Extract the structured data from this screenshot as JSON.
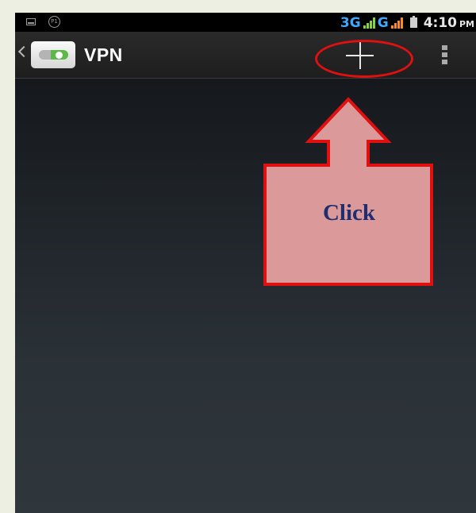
{
  "status_bar": {
    "left_icons": [
      "image-notification-icon",
      "p1-circle-icon"
    ],
    "p1_text": "P1",
    "network_1": "3G",
    "network_2": "G",
    "time": "4:10",
    "ampm": "PM",
    "colors": {
      "network": "#3fa9ff",
      "signal_1": "#8ad14a",
      "signal_2": "#ff8c1a"
    }
  },
  "action_bar": {
    "back_icon": "chevron-left-icon",
    "app_icon": "vpn-toggle-icon",
    "title": "VPN",
    "add_icon": "plus-icon",
    "menu_icon": "overflow-menu-icon"
  },
  "annotation": {
    "callout_text": "Click",
    "colors": {
      "outline": "#e01010",
      "fill": "#dc9999",
      "text": "#1f2e70"
    }
  }
}
